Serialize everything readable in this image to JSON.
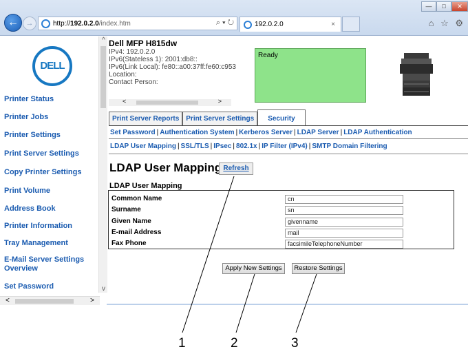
{
  "browser": {
    "url_host_prefix": "http://",
    "url_host": "192.0.2.0",
    "url_path": "/index.htm",
    "address_controls": "⌕ ▾ ↻",
    "tab_title": "192.0.2.0",
    "tab_close": "×",
    "win_minimize": "—",
    "win_maximize": "□",
    "win_close": "✕",
    "toolbar_icons": "⌂ ☆ ⚙"
  },
  "logo_text": "DELL",
  "sidebar": {
    "items": [
      {
        "label": "Printer Status"
      },
      {
        "label": "Printer Jobs"
      },
      {
        "label": "Printer Settings"
      },
      {
        "label": "Print Server Settings"
      },
      {
        "label": "Copy Printer Settings"
      },
      {
        "label": "Print Volume"
      },
      {
        "label": "Address Book"
      },
      {
        "label": "Printer Information"
      },
      {
        "label": "Tray Management"
      },
      {
        "label": "E-Mail Server Settings Overview"
      },
      {
        "label": "Set Password"
      }
    ]
  },
  "device": {
    "model": "Dell MFP H815dw",
    "ipv4": "IPv4: 192.0.2.0",
    "ipv6_stateless": "IPv6(Stateless 1): 2001:db8::",
    "ipv6_link": "IPv6(Link Local): fe80::a00:37ff:fe60:c953",
    "location": "Location:",
    "contact": "Contact Person:",
    "status": "Ready",
    "status_color": "#8ee38a"
  },
  "tabs": [
    {
      "label": "Print Server Reports"
    },
    {
      "label": "Print Server Settings"
    },
    {
      "label": "Security"
    }
  ],
  "sublinks_row1": [
    "Set Password",
    "Authentication System",
    "Kerberos Server",
    "LDAP Server",
    "LDAP Authentication"
  ],
  "sublinks_row2": [
    "LDAP User Mapping",
    "SSL/TLS",
    "IPsec",
    "802.1x",
    "IP Filter (IPv4)",
    "SMTP Domain Filtering"
  ],
  "sublink_separator": "|",
  "page": {
    "title": "LDAP User Mapping -",
    "refresh_label": "Refresh",
    "section_title": "LDAP User Mapping"
  },
  "mapping": [
    {
      "label": "Common Name",
      "value": "cn"
    },
    {
      "label": "Surname",
      "value": "sn"
    },
    {
      "label": "Given Name",
      "value": "givenname"
    },
    {
      "label": "E-mail Address",
      "value": "mail"
    },
    {
      "label": "Fax Phone",
      "value": "facsimileTelephoneNumber"
    }
  ],
  "buttons": {
    "apply": "Apply New Settings",
    "restore": "Restore Settings"
  },
  "callouts": [
    "1",
    "2",
    "3"
  ],
  "scroll_glyphs": {
    "up": "^",
    "down": "v",
    "left": "<",
    "right": ">"
  }
}
